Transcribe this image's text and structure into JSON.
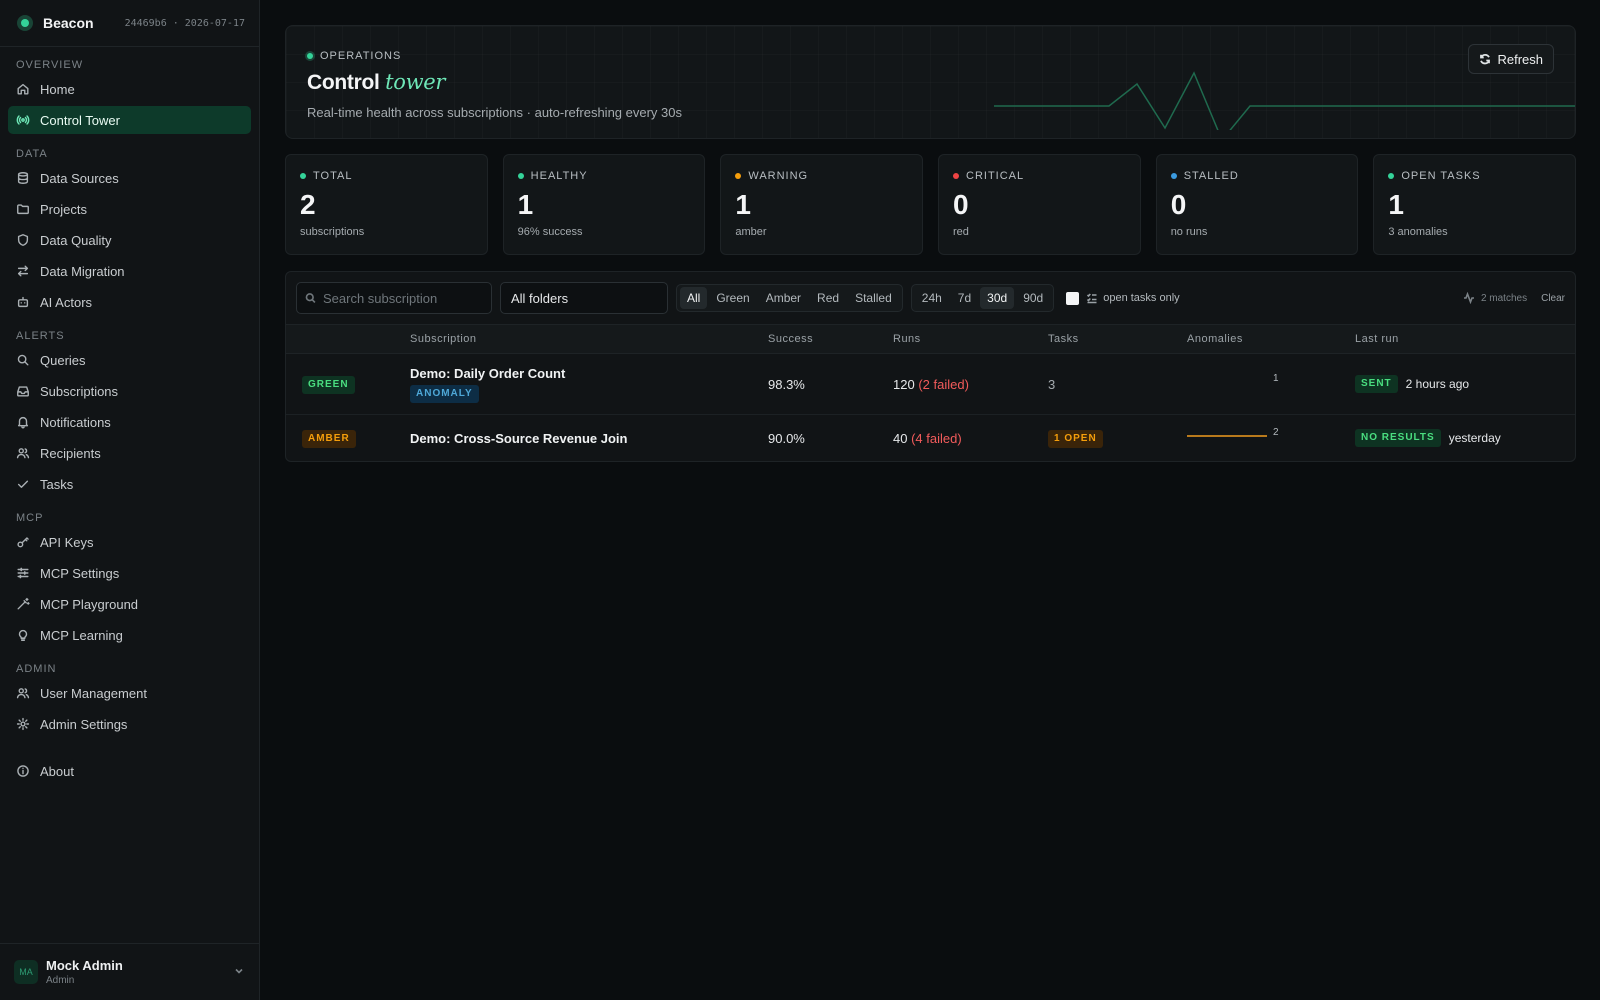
{
  "brand": {
    "name": "Beacon",
    "meta": "24469b6 · 2026-07-17"
  },
  "nav": {
    "overview": "OVERVIEW",
    "data": "DATA",
    "alerts": "ALERTS",
    "mcp": "MCP",
    "admin": "ADMIN",
    "items": {
      "home": "Home",
      "control_tower": "Control Tower",
      "data_sources": "Data Sources",
      "projects": "Projects",
      "data_quality": "Data Quality",
      "data_migration": "Data Migration",
      "ai_actors": "AI Actors",
      "queries": "Queries",
      "subscriptions": "Subscriptions",
      "notifications": "Notifications",
      "recipients": "Recipients",
      "tasks": "Tasks",
      "api_keys": "API Keys",
      "mcp_settings": "MCP Settings",
      "mcp_playground": "MCP Playground",
      "mcp_learning": "MCP Learning",
      "user_management": "User Management",
      "admin_settings": "Admin Settings",
      "about": "About"
    }
  },
  "user": {
    "initials": "MA",
    "name": "Mock Admin",
    "role": "Admin"
  },
  "hero": {
    "eyebrow": "OPERATIONS",
    "title_plain": "Control",
    "title_italic": "tower",
    "subtitle": "Real-time health across subscriptions · auto-refreshing every 30s",
    "refresh_label": "Refresh"
  },
  "stats": [
    {
      "label": "TOTAL",
      "value": "2",
      "sub": "subscriptions",
      "color": "#34d399"
    },
    {
      "label": "HEALTHY",
      "value": "1",
      "sub": "96% success",
      "color": "#34d399"
    },
    {
      "label": "WARNING",
      "value": "1",
      "sub": "amber",
      "color": "#f59e0b"
    },
    {
      "label": "CRITICAL",
      "value": "0",
      "sub": "red",
      "color": "#ef4444"
    },
    {
      "label": "STALLED",
      "value": "0",
      "sub": "no runs",
      "color": "#3b9be0"
    },
    {
      "label": "OPEN TASKS",
      "value": "1",
      "sub": "3 anomalies",
      "color": "#34d399"
    }
  ],
  "filters": {
    "search_placeholder": "Search subscription",
    "folder": "All folders",
    "status_options": [
      "All",
      "Green",
      "Amber",
      "Red",
      "Stalled"
    ],
    "status_selected": "All",
    "range_options": [
      "24h",
      "7d",
      "30d",
      "90d"
    ],
    "range_selected": "30d",
    "open_tasks_label": "open tasks only",
    "matches": "2 matches",
    "clear": "Clear"
  },
  "table": {
    "headers": {
      "subscription": "Subscription",
      "success": "Success",
      "runs": "Runs",
      "tasks": "Tasks",
      "anomalies": "Anomalies",
      "last_run": "Last run"
    },
    "rows": [
      {
        "status": "GREEN",
        "name": "Demo: Daily Order Count",
        "tag": "ANOMALY",
        "success": "98.3%",
        "runs": "120",
        "failed": "(2 failed)",
        "tasks": "3",
        "anomalies": "1",
        "last_status": "SENT",
        "last_time": "2 hours ago"
      },
      {
        "status": "AMBER",
        "name": "Demo: Cross-Source Revenue Join",
        "success": "90.0%",
        "runs": "40",
        "failed": "(4 failed)",
        "tasks": "1 OPEN",
        "anomalies": "2",
        "last_status": "NO RESULTS",
        "last_time": "yesterday"
      }
    ]
  },
  "colors": {
    "accent": "#34d399",
    "active_bg": "#0d3a2a",
    "warning": "#f59e0b",
    "danger": "#f25b5b"
  }
}
